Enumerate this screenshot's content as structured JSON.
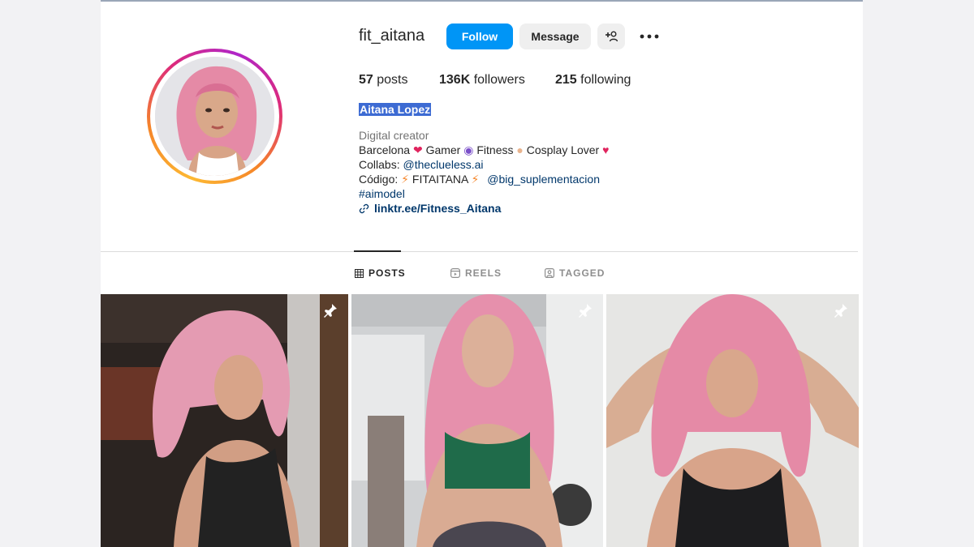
{
  "profile": {
    "username": "fit_aitana",
    "follow_label": "Follow",
    "message_label": "Message",
    "stats": {
      "posts_count": "57",
      "posts_label": "posts",
      "followers_count": "136K",
      "followers_label": "followers",
      "following_count": "215",
      "following_label": "following"
    },
    "full_name": "Aitana Lopez",
    "category": "Digital creator",
    "bio": {
      "line1_a": "Barcelona",
      "line1_b": "Gamer",
      "line1_c": "Fitness",
      "line1_d": "Cosplay Lover",
      "line2_prefix": "Collabs:",
      "line2_link": "@theclueless.ai",
      "line3_prefix": "Código:",
      "line3_code": "FITAITANA",
      "line3_link": "@big_suplementacion",
      "hashtag": "#aimodel",
      "website": "linktr.ee/Fitness_Aitana"
    }
  },
  "tabs": [
    {
      "label": "POSTS",
      "icon": "grid-icon",
      "active": true
    },
    {
      "label": "REELS",
      "icon": "reels-icon",
      "active": false
    },
    {
      "label": "TAGGED",
      "icon": "tagged-icon",
      "active": false
    }
  ],
  "posts": [
    {
      "pinned": true,
      "top": "black tank top",
      "bg": "#3a2f2a"
    },
    {
      "pinned": true,
      "top": "green crop top",
      "bg": "#c9ccd0"
    },
    {
      "pinned": true,
      "top": "black sports top",
      "bg": "#e9e9ea"
    }
  ],
  "colors": {
    "follow_button": "#0095f6",
    "link": "#00376b",
    "selection_highlight": "#3d6bd3",
    "hair": "#e58aa6"
  }
}
